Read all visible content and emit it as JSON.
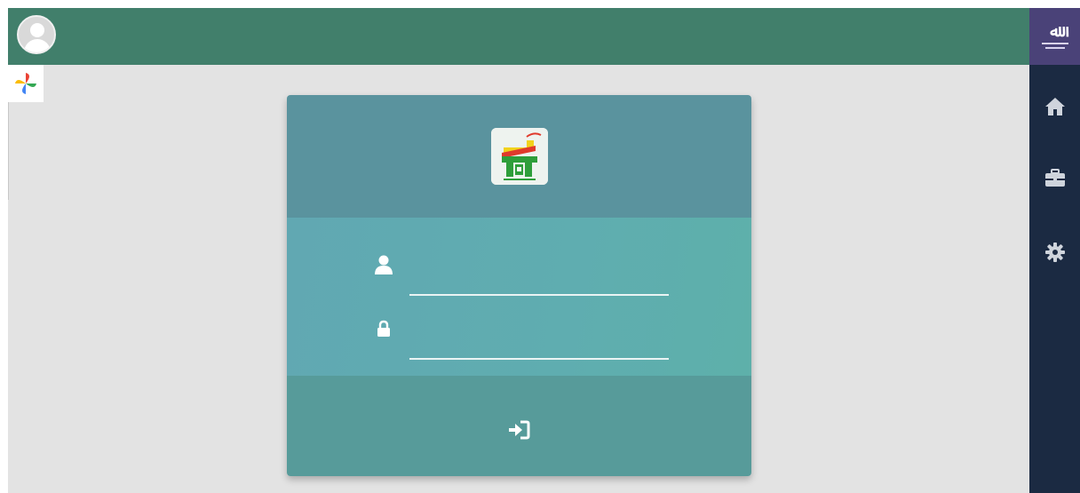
{
  "colors": {
    "topbar": "#417f6b",
    "sidebar": "#1b2a42",
    "emblem_bg": "#4a4278",
    "background": "#e3e3e3",
    "card_header": "#5a939e",
    "card_body": "#5fadb0",
    "card_footer": "#579b9a"
  },
  "header": {
    "avatar_icon": "user-avatar-icon",
    "app_icon": "pinwheel-icon"
  },
  "sidebar": {
    "emblem_icon": "iran-emblem-icon",
    "items": [
      {
        "icon": "home-icon"
      },
      {
        "icon": "briefcase-icon"
      },
      {
        "icon": "gear-icon"
      }
    ]
  },
  "login": {
    "logo_icon": "app-logo-icon",
    "username": {
      "icon": "user-icon",
      "value": "",
      "placeholder": ""
    },
    "password": {
      "icon": "lock-icon",
      "value": "",
      "placeholder": ""
    },
    "submit_icon": "sign-in-icon"
  }
}
